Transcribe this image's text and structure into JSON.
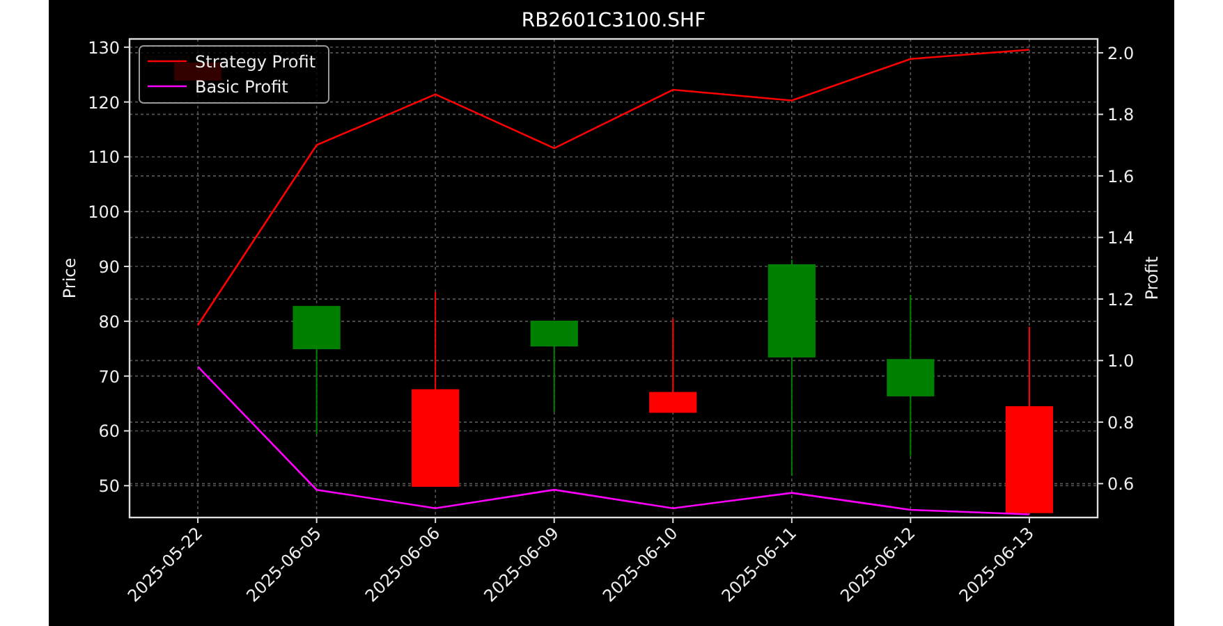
{
  "chart_data": {
    "type": "line",
    "title": "RB2601C3100.SHF",
    "ylabel": "Price",
    "y2label": "Profit",
    "grid": true,
    "legend": true,
    "categories": [
      "2025-05-22",
      "2025-06-05",
      "2025-06-06",
      "2025-06-09",
      "2025-06-10",
      "2025-06-11",
      "2025-06-12",
      "2025-06-13"
    ],
    "ylim": [
      44.2,
      131.5
    ],
    "yticks": [
      50,
      60,
      70,
      80,
      90,
      100,
      110,
      120,
      130
    ],
    "y2lim": [
      0.49,
      2.045
    ],
    "y2ticks": [
      {
        "value": 0.6,
        "label": "0.6"
      },
      {
        "value": 0.8,
        "label": "0.8"
      },
      {
        "value": 1.0,
        "label": "1.0"
      },
      {
        "value": 1.2,
        "label": "1.2"
      },
      {
        "value": 1.4,
        "label": "1.4"
      },
      {
        "value": 1.6,
        "label": "1.6"
      },
      {
        "value": 1.8,
        "label": "1.8"
      },
      {
        "value": 2.0,
        "label": "2.0"
      }
    ],
    "series": [
      {
        "type": "candlestick",
        "axis": "y",
        "ohlc": [
          [
            127.2,
            127.2,
            123.9,
            123.9
          ],
          [
            74.9,
            82.8,
            59.4,
            82.8
          ],
          [
            67.6,
            85.3,
            49.8,
            49.8
          ],
          [
            75.4,
            80.1,
            63.5,
            80.1
          ],
          [
            67.1,
            80.5,
            63.3,
            63.3
          ],
          [
            73.4,
            91.2,
            51.8,
            90.4
          ],
          [
            66.3,
            84.8,
            55.4,
            73.1
          ],
          [
            64.5,
            79.0,
            45.0,
            45.0
          ]
        ]
      },
      {
        "type": "line",
        "name": "Strategy Profit",
        "color": "#ff0000",
        "axis": "y2",
        "values": [
          1.115,
          1.7,
          1.865,
          1.69,
          1.88,
          1.845,
          1.98,
          2.01
        ]
      },
      {
        "type": "line",
        "name": "Basic Profit",
        "color": "#ff00ff",
        "axis": "y2",
        "values": [
          0.98,
          0.58,
          0.52,
          0.58,
          0.52,
          0.57,
          0.515,
          0.5
        ]
      }
    ]
  }
}
